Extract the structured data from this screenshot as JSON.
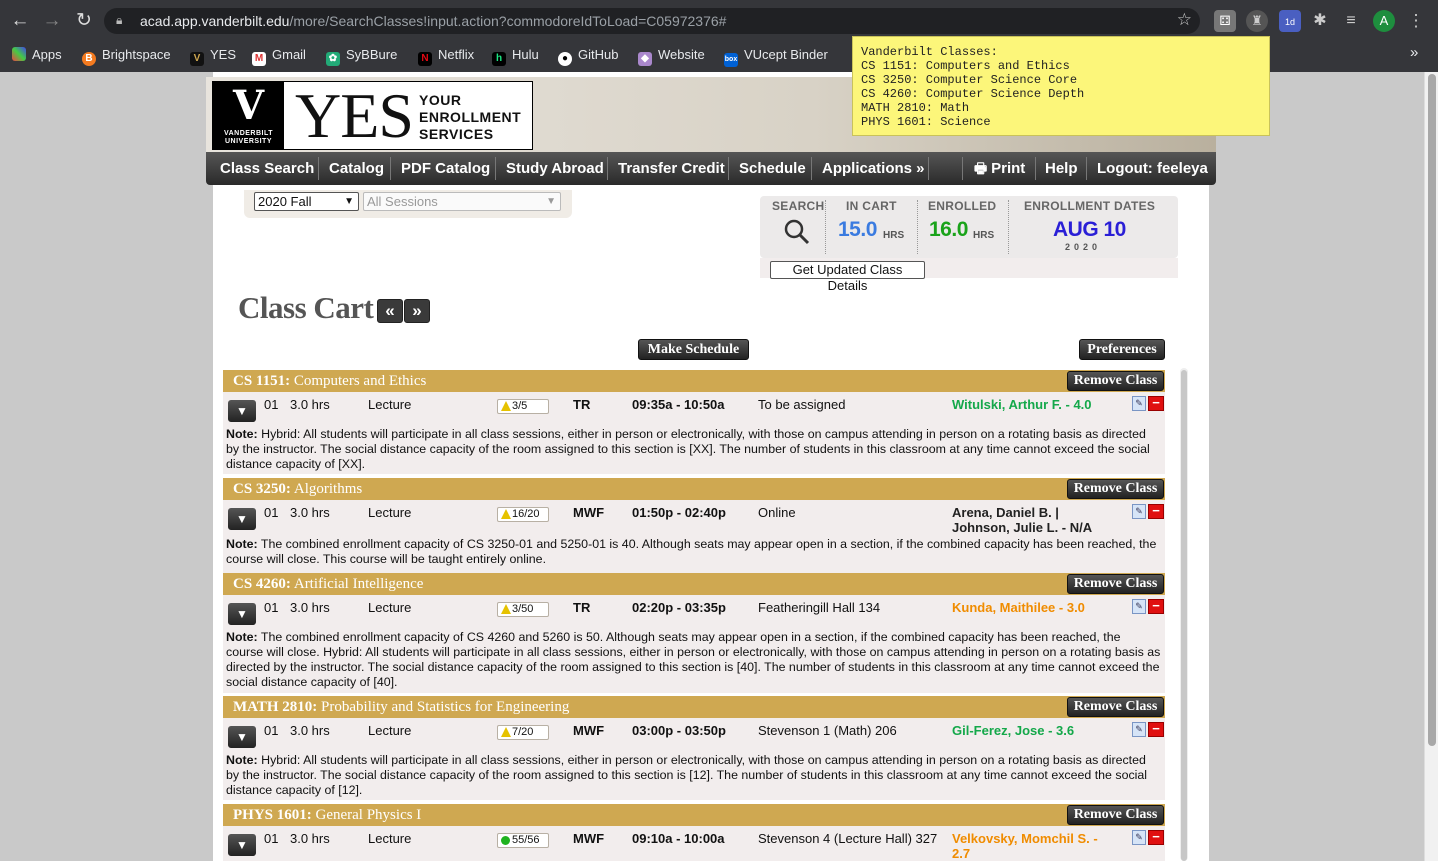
{
  "browser": {
    "url_host": "acad.app.vanderbilt.edu",
    "url_path": "/more/SearchClasses!input.action?commodoreIdToLoad=C05972376#",
    "profile_initial": "A",
    "ext_badge": "1d",
    "bookmarks": [
      "Apps",
      "Brightspace",
      "YES",
      "Gmail",
      "SyBBure",
      "Netflix",
      "Hulu",
      "GitHub",
      "Website",
      "VUcept Binder"
    ],
    "overflow": "»"
  },
  "sticky_note": "Vanderbilt Classes:\nCS 1151: Computers and Ethics\nCS 3250: Computer Science Core\nCS 4260: Computer Science Depth\nMATH 2810: Math\nPHYS 1601: Science",
  "logo": {
    "big": "YES",
    "line1": "YOUR",
    "line2": "ENROLLMENT",
    "line3": "SERVICES",
    "univ1": "VANDERBILT",
    "univ2": "UNIVERSITY"
  },
  "menu": {
    "items": [
      "Class Search",
      "Catalog",
      "PDF Catalog",
      "Study Abroad",
      "Transfer Credit",
      "Schedule",
      "Applications »"
    ],
    "print": "Print",
    "help": "Help",
    "logout": "Logout: feeleya"
  },
  "term": {
    "selected": "2020 Fall",
    "session": "All Sessions"
  },
  "stats": {
    "search_label": "SEARCH",
    "incart_label": "IN CART",
    "enrolled_label": "ENROLLED",
    "dates_label": "ENROLLMENT DATES",
    "incart": "15.0",
    "enrolled": "16.0",
    "unit": "HRS",
    "date": "AUG 10",
    "year": "2020",
    "incart_color": "#3a7be0",
    "enrolled_color": "#1aa31a",
    "date_color": "#2a1fd6",
    "update_button": "Get Updated Class Details"
  },
  "cart": {
    "title": "Class Cart",
    "prev": "«",
    "next": "»",
    "make_schedule": "Make Schedule",
    "preferences": "Preferences",
    "remove": "Remove Class",
    "note_label": "Note:",
    "courses": [
      {
        "code": "CS 1151:",
        "name": "Computers and Ethics",
        "section": "01",
        "hours": "3.0 hrs",
        "type": "Lecture",
        "seats": "3/5",
        "seat_status": "warning",
        "days": "TR",
        "time": "09:35a - 10:50a",
        "location": "To be assigned",
        "instructor": "Witulski, Arthur F. - 4.0",
        "instructor_color": "#14a84a",
        "note": "Hybrid: All students will participate in all class sessions, either in person or electronically, with those on campus attending in person on a rotating basis as directed by the instructor. The social distance capacity of the room assigned to this section is [XX]. The number of students in this classroom at any time cannot exceed the social distance capacity of [XX]."
      },
      {
        "code": "CS 3250:",
        "name": "Algorithms",
        "section": "01",
        "hours": "3.0 hrs",
        "type": "Lecture",
        "seats": "16/20",
        "seat_status": "warning",
        "days": "MWF",
        "time": "01:50p - 02:40p",
        "location": "Online",
        "instructor": "Arena, Daniel B. | Johnson, Julie L. - N/A",
        "instructor_color": "#222222",
        "note": "The combined enrollment capacity of CS 3250-01 and 5250-01 is 40. Although seats may appear open in a section, if the combined capacity has been reached, the course will close.   This course will be taught entirely online."
      },
      {
        "code": "CS 4260:",
        "name": "Artificial Intelligence",
        "section": "01",
        "hours": "3.0 hrs",
        "type": "Lecture",
        "seats": "3/50",
        "seat_status": "warning",
        "days": "TR",
        "time": "02:20p - 03:35p",
        "location": "Featheringill Hall 134",
        "instructor": "Kunda, Maithilee - 3.0",
        "instructor_color": "#f08c00",
        "note": "The combined enrollment capacity of CS 4260 and 5260 is 50. Although seats may appear open in a section, if the combined capacity has been reached, the course will close.   Hybrid: All students will participate in all class sessions, either in person or electronically, with those on campus attending in person on a rotating basis as directed by the instructor. The social distance capacity of the room assigned to this section is [40]. The number of students in this classroom at any time cannot exceed the social distance capacity of [40]."
      },
      {
        "code": "MATH 2810:",
        "name": "Probability and Statistics for Engineering",
        "section": "01",
        "hours": "3.0 hrs",
        "type": "Lecture",
        "seats": "7/20",
        "seat_status": "warning",
        "days": "MWF",
        "time": "03:00p - 03:50p",
        "location": "Stevenson 1 (Math) 206",
        "instructor": "Gil-Ferez, Jose - 3.6",
        "instructor_color": "#14a84a",
        "note": "Hybrid: All students will participate in all class sessions, either in person or electronically, with those on campus attending in person on a rotating basis as directed by the instructor. The social distance capacity of the room assigned to this section is [12]. The number of students in this classroom at any time cannot exceed the social distance capacity of [12]."
      },
      {
        "code": "PHYS 1601:",
        "name": "General Physics I",
        "section": "01",
        "hours": "3.0 hrs",
        "type": "Lecture",
        "seats": "55/56",
        "seat_status": "open",
        "days": "MWF",
        "time": "09:10a - 10:00a",
        "location": "Stevenson 4 (Lecture Hall) 327",
        "instructor": "Velkovsky, Momchil S. - 2.7",
        "instructor_color": "#f08c00",
        "note": ""
      }
    ]
  }
}
